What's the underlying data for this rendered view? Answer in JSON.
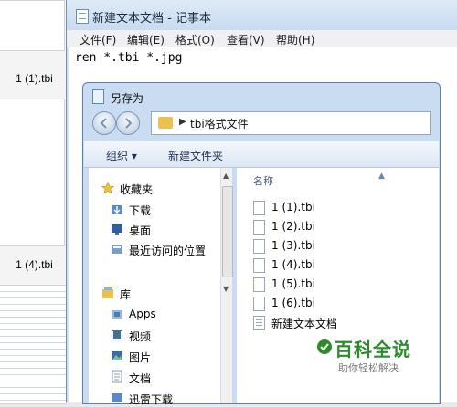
{
  "background": {
    "thumb_labels": [
      "1 (1).tbi",
      "1 (4).tbi"
    ]
  },
  "notepad": {
    "title": "新建文本文档 - 记事本",
    "menu": [
      "文件(F)",
      "编辑(E)",
      "格式(O)",
      "查看(V)",
      "帮助(H)"
    ],
    "content": "ren *.tbi *.jpg"
  },
  "dialog": {
    "title": "另存为",
    "address": "tbi格式文件",
    "toolbar": {
      "organize": "组织 ▾",
      "new_folder": "新建文件夹"
    },
    "nav_items": [
      "收藏夹",
      "下载",
      "桌面",
      "最近访问的位置",
      "库",
      "Apps",
      "视频",
      "图片",
      "文档",
      "迅雷下载"
    ],
    "column_header": "名称",
    "files": [
      "1 (1).tbi",
      "1 (2).tbi",
      "1 (3).tbi",
      "1 (4).tbi",
      "1 (5).tbi",
      "1 (6).tbi",
      "新建文本文档"
    ]
  },
  "watermark": {
    "main": "百科全说",
    "sub": "助你轻松解决"
  },
  "colors": {
    "window_frame": "#c9dcf1",
    "watermark_green": "#2d8a2d",
    "folder_yellow": "#e8c14f"
  }
}
